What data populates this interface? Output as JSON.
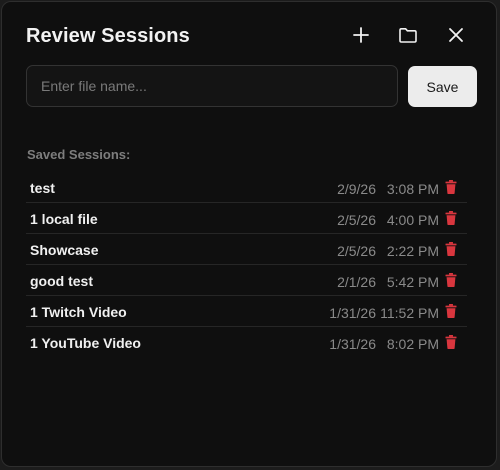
{
  "header": {
    "title": "Review Sessions",
    "icons": {
      "new": "plus-icon",
      "open": "folder-icon",
      "close": "close-icon"
    }
  },
  "form": {
    "placeholder": "Enter file name...",
    "value": "",
    "save_label": "Save"
  },
  "sessions": {
    "label": "Saved Sessions:",
    "items": [
      {
        "name": "test",
        "date": "2/9/26",
        "time": "3:08 PM"
      },
      {
        "name": "1 local file",
        "date": "2/5/26",
        "time": "4:00 PM"
      },
      {
        "name": "Showcase",
        "date": "2/5/26",
        "time": "2:22 PM"
      },
      {
        "name": "good test",
        "date": "2/1/26",
        "time": "5:42 PM"
      },
      {
        "name": "1 Twitch Video",
        "date": "1/31/26",
        "time": "11:52 PM"
      },
      {
        "name": "1 YouTube Video",
        "date": "1/31/26",
        "time": "8:02 PM"
      }
    ],
    "delete_icon": "trash-icon"
  },
  "colors": {
    "background": "#0f0f0f",
    "text": "#f0f0f0",
    "muted": "#8a8a8a",
    "danger": "#d9363e",
    "button_bg": "#ececec"
  }
}
